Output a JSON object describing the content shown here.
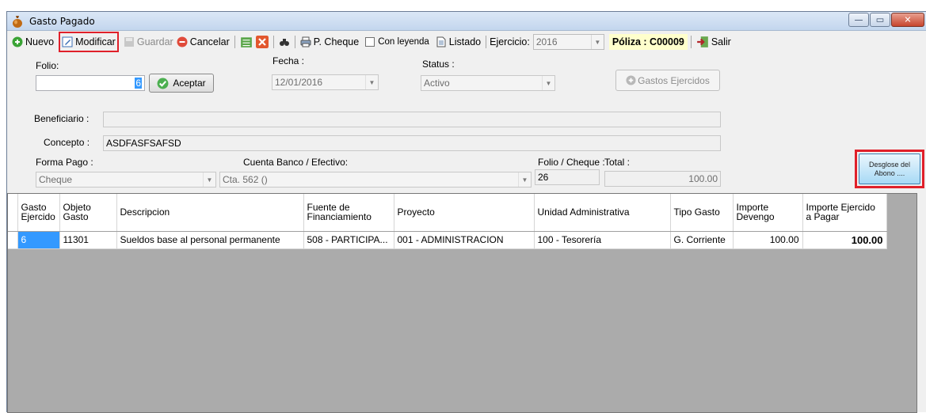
{
  "window": {
    "title": "Gasto Pagado",
    "controls": [
      "minimize",
      "maximize",
      "close"
    ]
  },
  "toolbar": {
    "nuevo": "Nuevo",
    "modificar": "Modificar",
    "guardar": "Guardar",
    "cancelar": "Cancelar",
    "pcheque": "P. Cheque",
    "con_leyenda": "Con leyenda",
    "listado": "Listado",
    "ejercicio_label": "Ejercicio:",
    "ejercicio_value": "2016",
    "poliza": "Póliza : C00009",
    "salir": "Salir"
  },
  "form": {
    "folio_label": "Folio:",
    "folio_value": "6",
    "aceptar": "Aceptar",
    "fecha_label": "Fecha :",
    "fecha_value": "12/01/2016",
    "status_label": "Status :",
    "status_value": "Activo",
    "gastos_ejercidos": "Gastos Ejercidos",
    "beneficiario_label": "Beneficiario :",
    "beneficiario_value": "",
    "concepto_label": "Concepto :",
    "concepto_value": "ASDFASFSAFSD",
    "forma_pago_label": "Forma Pago :",
    "forma_pago_value": "Cheque",
    "cuenta_label": "Cuenta Banco / Efectivo:",
    "cuenta_value": "Cta. 562 ()",
    "folio_cheque_label": "Folio / Cheque :",
    "folio_cheque_value": "26",
    "total_label": "Total :",
    "total_value": "100.00",
    "desglose_line1": "Desglose del",
    "desglose_line2": "Abono ...."
  },
  "grid": {
    "headers": [
      "Gasto Ejercido",
      "Objeto Gasto",
      "Descripcion",
      "Fuente de Financiamiento",
      "Proyecto",
      "Unidad Administrativa",
      "Tipo Gasto",
      "Importe Devengo",
      "Importe Ejercido a Pagar"
    ],
    "rows": [
      [
        "6",
        "11301",
        "Sueldos base al personal permanente",
        "508 - PARTICIPA...",
        "001 - ADMINISTRACION",
        "100 - Tesorería",
        "G. Corriente",
        "100.00",
        "100.00"
      ]
    ]
  },
  "colors": {
    "highlight_box": "#e0202a",
    "selection": "#3399ff",
    "poliza_bg": "#ffffcc"
  }
}
